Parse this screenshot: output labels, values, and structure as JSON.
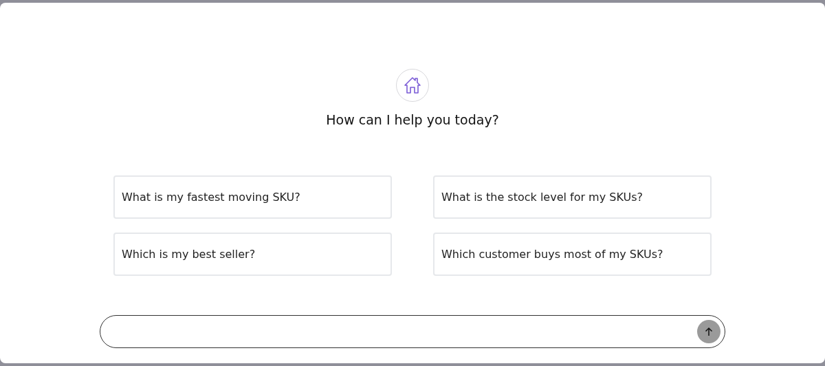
{
  "heading": "How can I help you today?",
  "suggestions": [
    {
      "label": "What is my fastest moving SKU?"
    },
    {
      "label": "What is the stock level for my SKUs?"
    },
    {
      "label": "Which is my best seller?"
    },
    {
      "label": "Which customer buys most of my SKUs?"
    }
  ]
}
